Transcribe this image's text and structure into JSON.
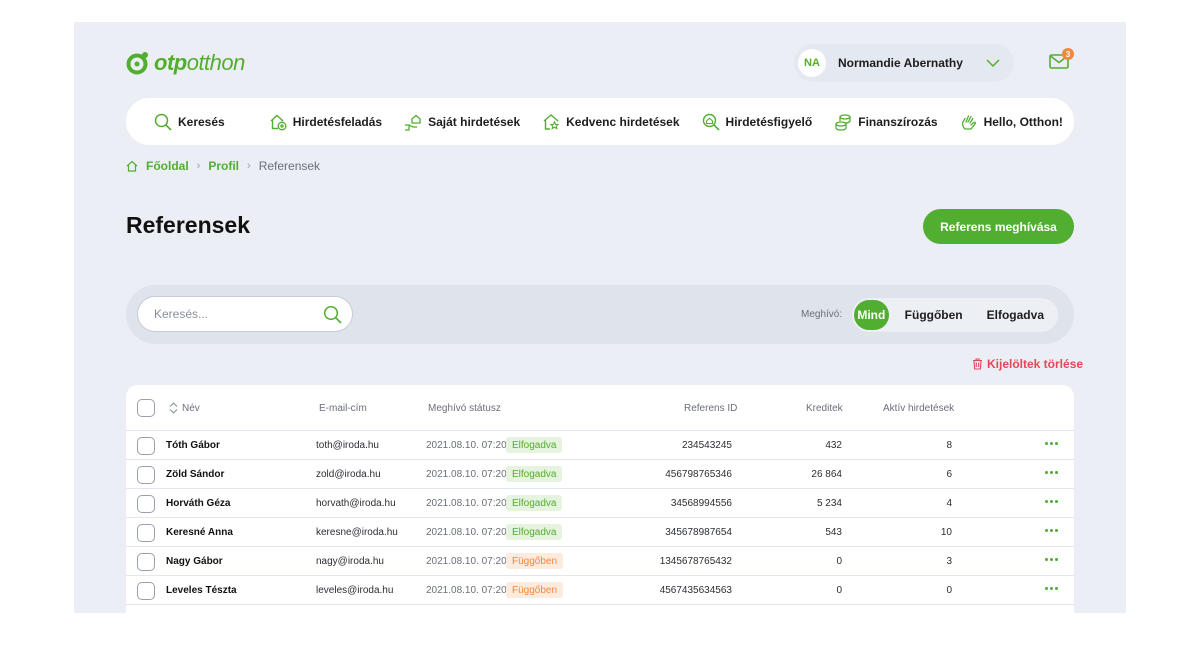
{
  "brand": {
    "name_prefix": "otp",
    "name_suffix": "otthon",
    "accent": "#52ae30"
  },
  "user": {
    "initials": "NA",
    "name": "Normandie Abernathy"
  },
  "mail": {
    "badge_count": "3"
  },
  "nav": [
    {
      "label": "Keresés",
      "icon": "search-icon"
    },
    {
      "label": "Hirdetésfeladás",
      "icon": "house-add-icon"
    },
    {
      "label": "Saját hirdetések",
      "icon": "hand-house-icon"
    },
    {
      "label": "Kedvenc hirdetések",
      "icon": "house-star-icon"
    },
    {
      "label": "Hirdetésfigyelő",
      "icon": "search-house-icon"
    },
    {
      "label": "Finanszírozás",
      "icon": "coins-icon"
    },
    {
      "label": "Hello, Otthon!",
      "icon": "wave-hand-icon"
    }
  ],
  "breadcrumb": {
    "home": "Főoldal",
    "profile": "Profil",
    "current": "Referensek"
  },
  "page": {
    "title": "Referensek",
    "invite_button": "Referens meghívása"
  },
  "filter": {
    "search_placeholder": "Keresés...",
    "label": "Meghívó:",
    "options": [
      "Mind",
      "Függőben",
      "Elfogadva"
    ],
    "selected": "Mind"
  },
  "delete_selected": "Kijelöltek törlése",
  "table": {
    "headers": {
      "name": "Név",
      "email": "E-mail-cím",
      "status": "Meghívó státusz",
      "ref_id": "Referens ID",
      "credits": "Kreditek",
      "active": "Aktív hirdetések"
    },
    "rows": [
      {
        "name": "Tóth Gábor",
        "email": "toth@iroda.hu",
        "date": "2021.08.10. 07:20",
        "status": "Elfogadva",
        "ref_id": "234543245",
        "credits": "432",
        "active": "8"
      },
      {
        "name": "Zöld Sándor",
        "email": "zold@iroda.hu",
        "date": "2021.08.10. 07:20",
        "status": "Elfogadva",
        "ref_id": "456798765346",
        "credits": "26 864",
        "active": "6"
      },
      {
        "name": "Horváth Géza",
        "email": "horvath@iroda.hu",
        "date": "2021.08.10. 07:20",
        "status": "Elfogadva",
        "ref_id": "34568994556",
        "credits": "5 234",
        "active": "4"
      },
      {
        "name": "Keresné Anna",
        "email": "keresne@iroda.hu",
        "date": "2021.08.10. 07:20",
        "status": "Elfogadva",
        "ref_id": "345678987654",
        "credits": "543",
        "active": "10"
      },
      {
        "name": "Nagy Gábor",
        "email": "nagy@iroda.hu",
        "date": "2021.08.10. 07:20",
        "status": "Függőben",
        "ref_id": "1345678765432",
        "credits": "0",
        "active": "3"
      },
      {
        "name": "Leveles Tészta",
        "email": "leveles@iroda.hu",
        "date": "2021.08.10. 07:20",
        "status": "Függőben",
        "ref_id": "4567435634563",
        "credits": "0",
        "active": "0"
      }
    ]
  }
}
